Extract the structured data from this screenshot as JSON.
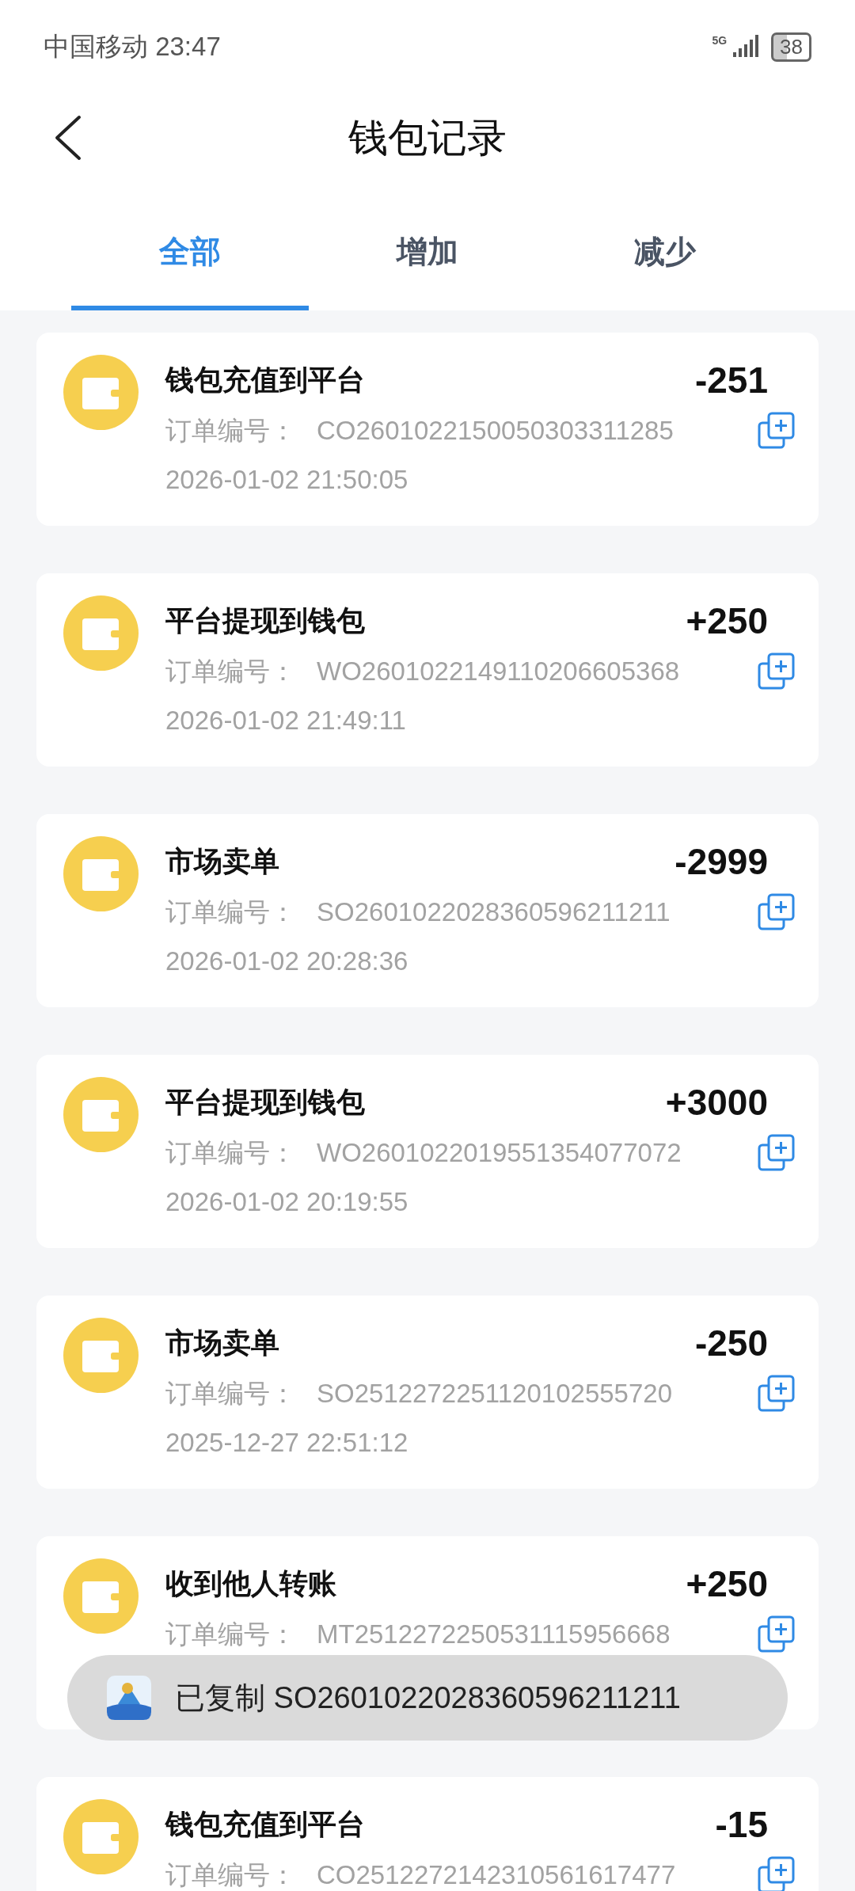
{
  "status_bar": {
    "carrier_time": "中国移动 23:47",
    "network": "5G",
    "battery": "38"
  },
  "header": {
    "title": "钱包记录"
  },
  "tabs": [
    {
      "label": "全部",
      "selected": true
    },
    {
      "label": "增加",
      "selected": false
    },
    {
      "label": "减少",
      "selected": false
    }
  ],
  "records": [
    {
      "title": "钱包充值到平台",
      "amount": "-251",
      "order_label": "订单编号：",
      "order_no": "CO2601022150050303311285",
      "date": "2026-01-02 21:50:05"
    },
    {
      "title": "平台提现到钱包",
      "amount": "+250",
      "order_label": "订单编号：",
      "order_no": "WO2601022149110206605368",
      "date": "2026-01-02 21:49:11"
    },
    {
      "title": "市场卖单",
      "amount": "-2999",
      "order_label": "订单编号：",
      "order_no": "SO2601022028360596211211",
      "date": "2026-01-02 20:28:36"
    },
    {
      "title": "平台提现到钱包",
      "amount": "+3000",
      "order_label": "订单编号：",
      "order_no": "WO2601022019551354077072",
      "date": "2026-01-02 20:19:55"
    },
    {
      "title": "市场卖单",
      "amount": "-250",
      "order_label": "订单编号：",
      "order_no": "SO2512272251120102555720",
      "date": "2025-12-27 22:51:12"
    },
    {
      "title": "收到他人转账",
      "amount": "+250",
      "order_label": "订单编号：",
      "order_no": "MT2512272250531115956668"
    },
    {
      "title": "钱包充值到平台",
      "amount": "-15",
      "order_label": "订单编号：",
      "order_no": "CO2512272142310561617477"
    }
  ],
  "toast": {
    "text": "已复制 SO2601022028360596211211"
  }
}
